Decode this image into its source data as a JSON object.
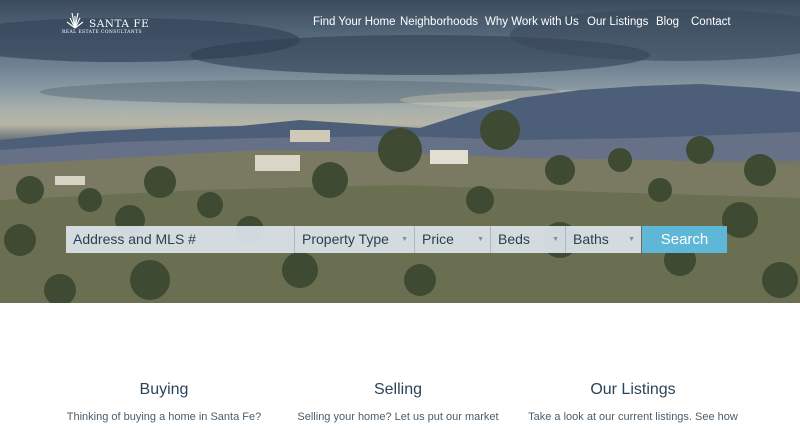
{
  "brand": {
    "name": "SANTA FE",
    "tagline": "REAL ESTATE CONSULTANTS"
  },
  "nav": {
    "items": [
      {
        "label": "Find Your Home"
      },
      {
        "label": "Neighborhoods"
      },
      {
        "label": "Why Work with Us"
      },
      {
        "label": "Our Listings"
      },
      {
        "label": "Blog"
      },
      {
        "label": "Contact"
      }
    ]
  },
  "search": {
    "address_placeholder": "Address and MLS #",
    "property_type": "Property Type",
    "price": "Price",
    "beds": "Beds",
    "baths": "Baths",
    "button": "Search"
  },
  "sections": [
    {
      "title": "Buying",
      "text": "Thinking of buying a home in Santa Fe?"
    },
    {
      "title": "Selling",
      "text": "Selling your home? Let us put our market"
    },
    {
      "title": "Our Listings",
      "text": "Take a look at our current listings. See how"
    }
  ],
  "colors": {
    "search_button": "#5eb7d6",
    "heading": "#2c4458"
  }
}
